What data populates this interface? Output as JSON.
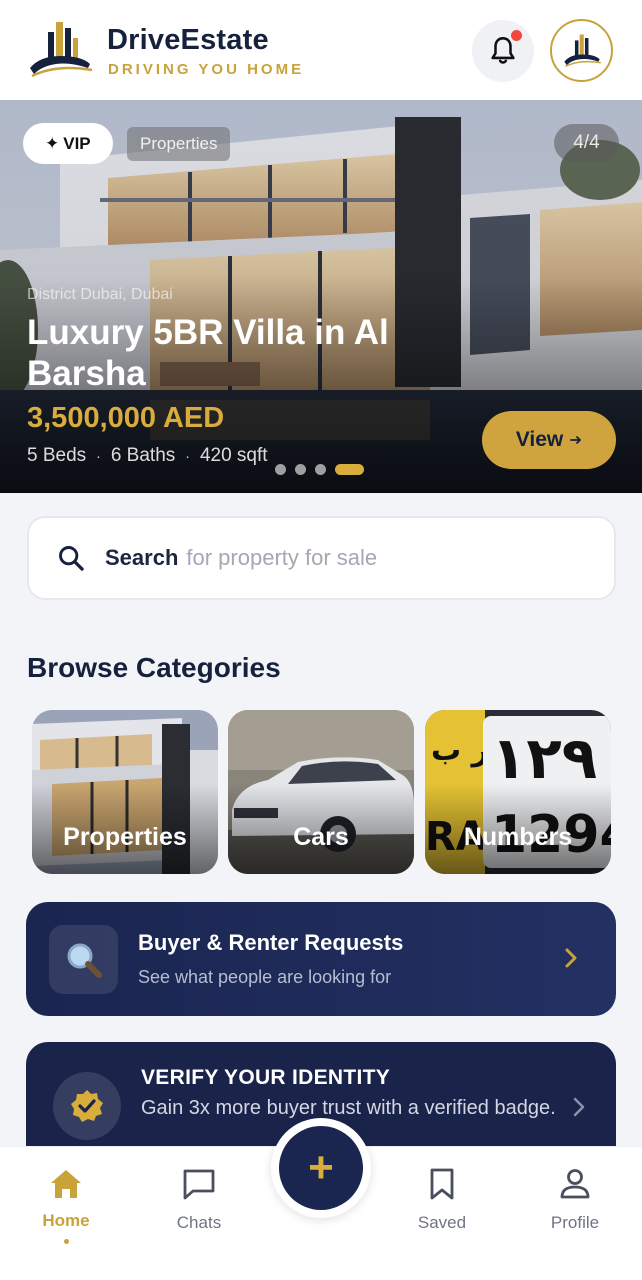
{
  "header": {
    "brand_name": "DriveEstate",
    "brand_tagline": "DRIVING YOU HOME",
    "notification_dot": true
  },
  "hero": {
    "vip_badge": "VIP",
    "category_chip": "Properties",
    "counter": "4/4",
    "location": "District Dubai, Dubai",
    "title": "Luxury 5BR Villa in Al Barsha",
    "price": "3,500,000 AED",
    "beds": "5 Beds",
    "baths": "6 Baths",
    "area": "420 sqft",
    "spec_separator": "·",
    "view_label": "View",
    "slides": 4,
    "active_slide": 4
  },
  "search": {
    "bold_label": "Search",
    "placeholder": "for property for sale"
  },
  "categories": {
    "title": "Browse Categories",
    "items": [
      {
        "label": "Properties"
      },
      {
        "label": "Cars"
      },
      {
        "label": "Numbers"
      }
    ]
  },
  "requests_card": {
    "title": "Buyer & Renter Requests",
    "subtitle": "See what people are looking for"
  },
  "verify_card": {
    "title": "VERIFY YOUR IDENTITY",
    "subtitle": "Gain 3x more buyer trust with a verified badge."
  },
  "bottom_nav": {
    "items": [
      {
        "label": "Home",
        "icon": "home-icon",
        "active": true
      },
      {
        "label": "Chats",
        "icon": "chat-icon"
      },
      {
        "label": "Saved",
        "icon": "bookmark-icon"
      },
      {
        "label": "Profile",
        "icon": "user-icon"
      }
    ],
    "fab_icon": "plus-icon",
    "fab_symbol": "+"
  },
  "colors": {
    "navy": "#16213e",
    "gold": "#c9a23a",
    "background": "#f3f4f7",
    "notification": "#f0473e"
  }
}
